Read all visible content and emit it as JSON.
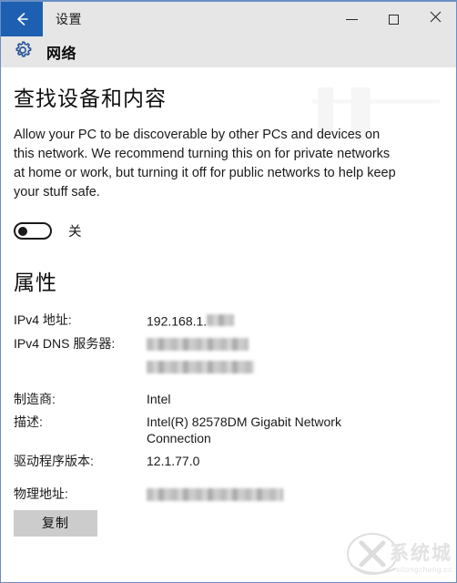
{
  "window": {
    "title": "设置",
    "back_icon": "back-arrow-icon",
    "controls": {
      "minimize": "minimize-icon",
      "maximize": "maximize-icon",
      "close": "close-icon"
    }
  },
  "app_header": {
    "icon": "gear-icon",
    "title": "网络"
  },
  "discovery": {
    "heading": "查找设备和内容",
    "description": "Allow your PC to be discoverable by other PCs and devices on this network. We recommend turning this on for private networks at home or work, but turning it off for public networks to help keep your stuff safe.",
    "toggle_state": "off",
    "toggle_label": "关"
  },
  "properties": {
    "heading": "属性",
    "rows": [
      {
        "key": "IPv4 地址:",
        "value": "192.168.1.",
        "redacted": true,
        "redact_class": "short"
      },
      {
        "key": "IPv4 DNS 服务器:",
        "value": "",
        "redacted": true,
        "redact_class": "dns1"
      },
      {
        "key": "",
        "value": "",
        "redacted": true,
        "redact_class": "dns2"
      },
      {
        "key": "制造商:",
        "value": "Intel",
        "redacted": false,
        "redact_class": ""
      },
      {
        "key": "描述:",
        "value": "Intel(R) 82578DM Gigabit Network Connection",
        "redacted": false,
        "redact_class": ""
      },
      {
        "key": "驱动程序版本:",
        "value": "12.1.77.0",
        "redacted": false,
        "redact_class": ""
      },
      {
        "key": "物理地址:",
        "value": "",
        "redacted": true,
        "redact_class": "mac"
      }
    ],
    "copy_button": "复制"
  },
  "watermark": {
    "brand": "系统城",
    "domain": "xitongcheng.cc"
  },
  "colors": {
    "accent_blue": "#1d5fb0",
    "gear_blue": "#2b579a",
    "titlebar_bg": "#e6e6e6",
    "content_bg": "#ffffff",
    "button_bg": "#cccccc",
    "window_border": "#6a8fc4"
  }
}
